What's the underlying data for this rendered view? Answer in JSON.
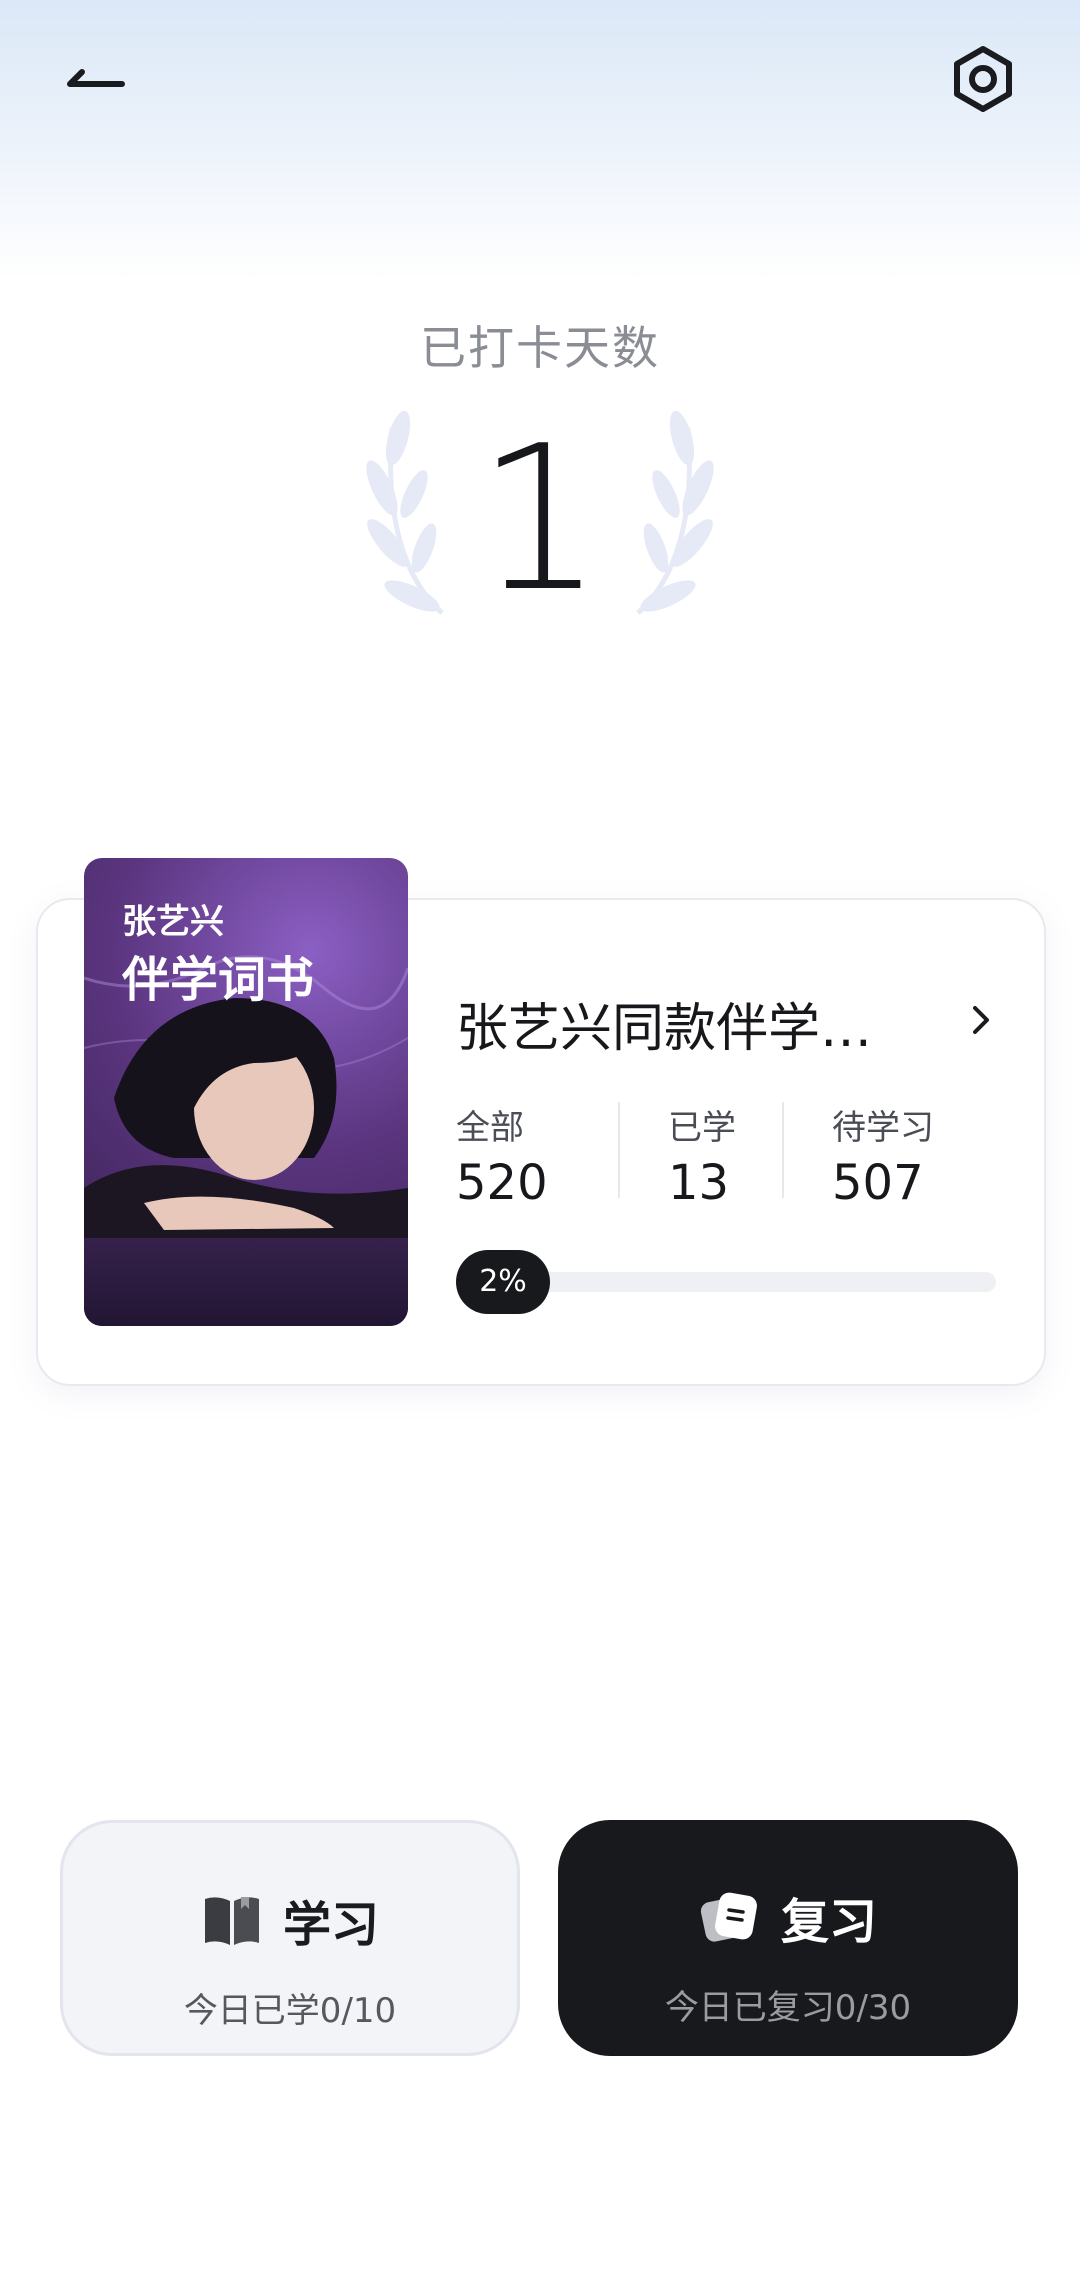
{
  "streak": {
    "label": "已打卡天数",
    "days": "1"
  },
  "book": {
    "cover_line1": "张艺兴",
    "cover_line2": "伴学词书",
    "title": "张艺兴同款伴学词…",
    "stats": {
      "total_label": "全部",
      "total_value": "520",
      "learned_label": "已学",
      "learned_value": "13",
      "pending_label": "待学习",
      "pending_value": "507"
    },
    "progress_label": "2%",
    "progress_fraction": 0.02
  },
  "actions": {
    "learn": {
      "title": "学习",
      "subtitle": "今日已学0/10",
      "icon": "open-book-icon"
    },
    "review": {
      "title": "复习",
      "subtitle": "今日已复习0/30",
      "icon": "review-cards-icon"
    }
  },
  "icons": {
    "back": "back-arrow-icon",
    "settings": "settings-icon",
    "chevron": "chevron-right-icon"
  },
  "colors": {
    "accent_dark": "#18191c",
    "laurel": "#e6e9f6",
    "cover_purple": "#5b357f"
  }
}
